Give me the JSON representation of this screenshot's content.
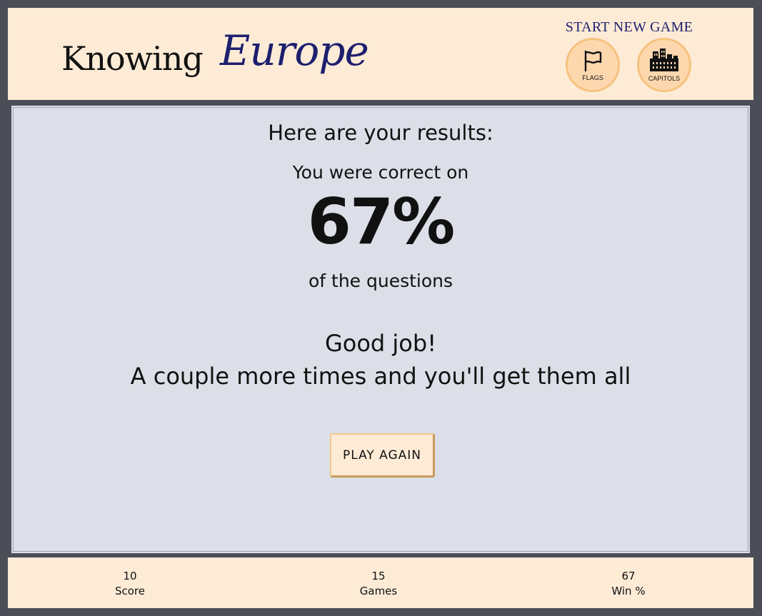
{
  "header": {
    "logo_knowing": "Knowing",
    "logo_europe": "Europe",
    "new_game_title": "START NEW GAME",
    "modes": [
      {
        "label": "FLAGS",
        "icon": "flag-icon"
      },
      {
        "label": "CAPITOLS",
        "icon": "city-icon"
      }
    ]
  },
  "results": {
    "heading": "Here are your results:",
    "correct_on": "You were correct on",
    "percent": "67%",
    "of_questions": "of the questions",
    "message_line1": "Good job!",
    "message_line2": "A couple more times and you'll get them all",
    "play_again_label": "PLAY AGAIN"
  },
  "stats": [
    {
      "value": "10",
      "label": "Score"
    },
    {
      "value": "15",
      "label": "Games"
    },
    {
      "value": "67",
      "label": "Win %"
    }
  ],
  "colors": {
    "page_bg": "#4b4e57",
    "panel_bg": "#fdebd6",
    "main_bg": "#dcdfe7",
    "brand_navy": "#1d1f6e",
    "button_accent": "#f6c27e"
  }
}
